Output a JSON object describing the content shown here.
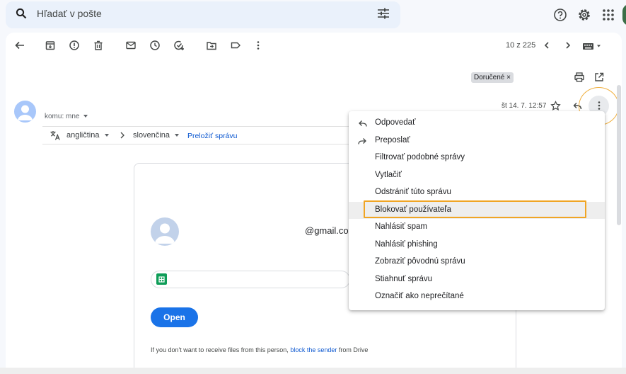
{
  "search": {
    "placeholder": "Hľadať v pošte"
  },
  "toolbar": {
    "counter": "10 z 225"
  },
  "message": {
    "label_chip": "Doručené ×",
    "to_line": "komu: mne",
    "date": "št 14. 7. 12:57"
  },
  "translate": {
    "source_lang": "angličtina",
    "target_lang": "slovenčina",
    "translate_link": "Preložiť správu"
  },
  "card": {
    "sender_email_fragment": "@gmail.com",
    "open_label": "Open",
    "footer_prefix": "If you don't want to receive files from this person,",
    "footer_link": "block the sender",
    "footer_suffix": "from Drive"
  },
  "menu": {
    "items": [
      {
        "label": "Odpovedať",
        "icon": "reply-icon"
      },
      {
        "label": "Preposlať",
        "icon": "forward-icon"
      },
      {
        "label": "Filtrovať podobné správy",
        "icon": ""
      },
      {
        "label": "Vytlačiť",
        "icon": ""
      },
      {
        "label": "Odstrániť túto správu",
        "icon": ""
      },
      {
        "label": "Blokovať používateľa",
        "icon": "",
        "highlighted": true
      },
      {
        "label": "Nahlásiť spam",
        "icon": ""
      },
      {
        "label": "Nahlásiť phishing",
        "icon": ""
      },
      {
        "label": "Zobraziť pôvodnú správu",
        "icon": ""
      },
      {
        "label": "Stiahnuť správu",
        "icon": ""
      },
      {
        "label": "Označiť ako neprečítané",
        "icon": ""
      }
    ]
  },
  "colors": {
    "highlight": "#f0a525",
    "accent": "#1a73e8",
    "link": "#0b57d0"
  }
}
